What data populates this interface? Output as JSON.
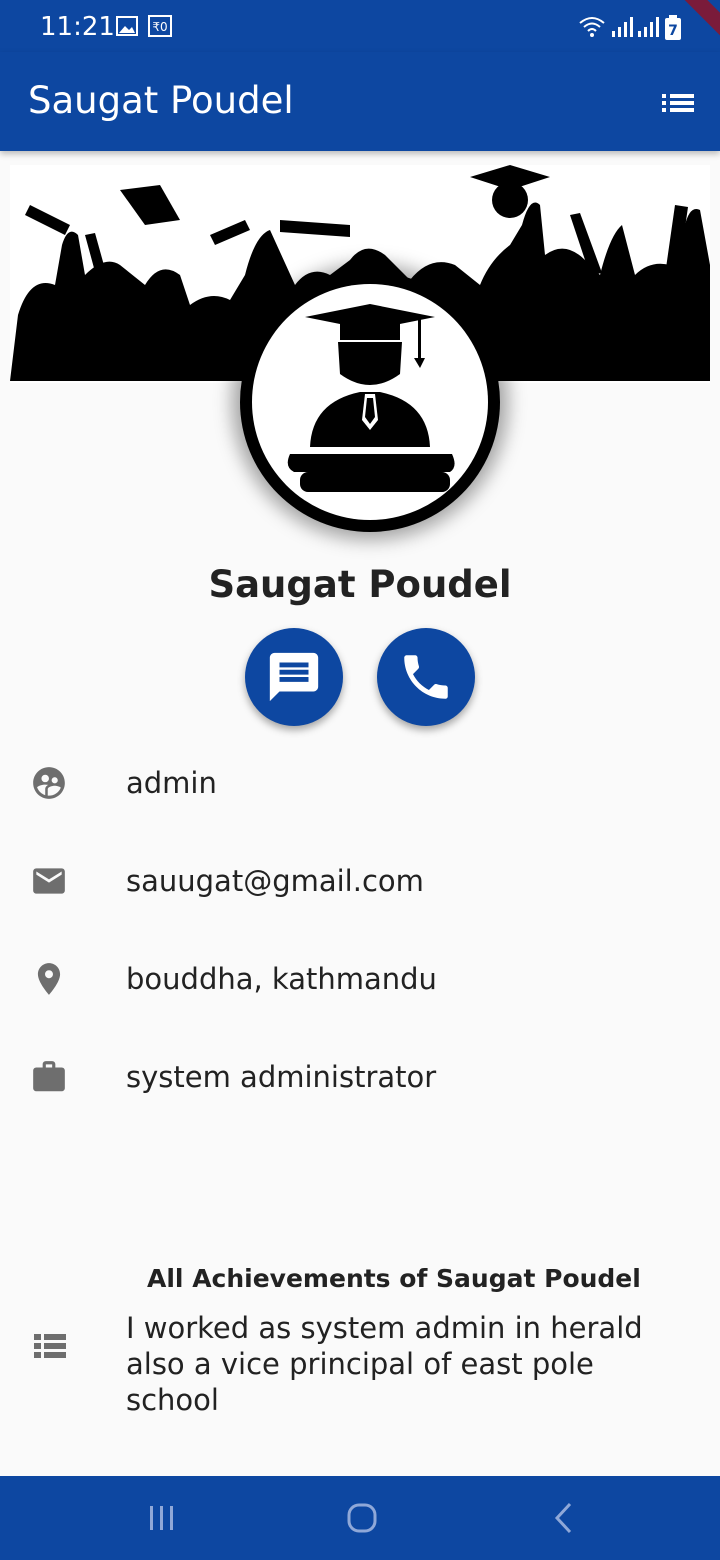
{
  "status_bar": {
    "time": "11:21",
    "icons": [
      "image-icon",
      "sim-icon",
      "wifi-icon",
      "signal-icon",
      "signal-icon",
      "battery-icon"
    ],
    "battery_level": "7"
  },
  "app_bar": {
    "title": "Saugat Poudel",
    "menu_icon": "list-icon",
    "color": "#0d47a1"
  },
  "profile": {
    "name": "Saugat Poudel",
    "actions": [
      {
        "icon": "message-icon"
      },
      {
        "icon": "phone-icon"
      }
    ]
  },
  "details": [
    {
      "icon": "group-icon",
      "text": "admin"
    },
    {
      "icon": "email-icon",
      "text": "sauugat@gmail.com"
    },
    {
      "icon": "location-pin-icon",
      "text": "bouddha, kathmandu"
    },
    {
      "icon": "briefcase-icon",
      "text": "system administrator"
    }
  ],
  "achievements": {
    "title": "All Achievements of Saugat Poudel",
    "text": "I worked as system admin in herald also a vice principal of east pole school",
    "icon": "list-icon"
  },
  "nav_bar": {
    "buttons": [
      "recents-icon",
      "home-icon",
      "back-icon"
    ]
  }
}
